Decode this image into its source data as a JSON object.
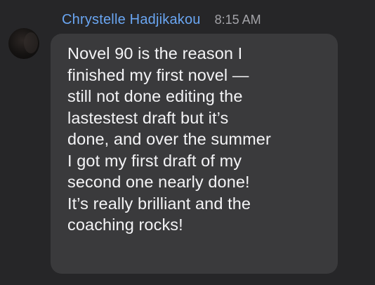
{
  "message": {
    "sender_name": "Chrystelle Hadjikakou",
    "timestamp": "8:15 AM",
    "avatar_icon": "user-avatar-photo",
    "body_lines": [
      "Novel 90 is the reason I",
      "finished my first novel —",
      "still not done editing the",
      "lastestest draft but it’s",
      "done, and over the summer",
      "I got my first draft of my",
      "second one nearly done!",
      "It’s really brilliant and the",
      "coaching rocks!"
    ]
  },
  "colors": {
    "background": "#262628",
    "bubble": "#3a3a3c",
    "sender_name": "#6aa6f2",
    "timestamp": "#a3a3a8",
    "body_text": "#f4f4f6"
  }
}
